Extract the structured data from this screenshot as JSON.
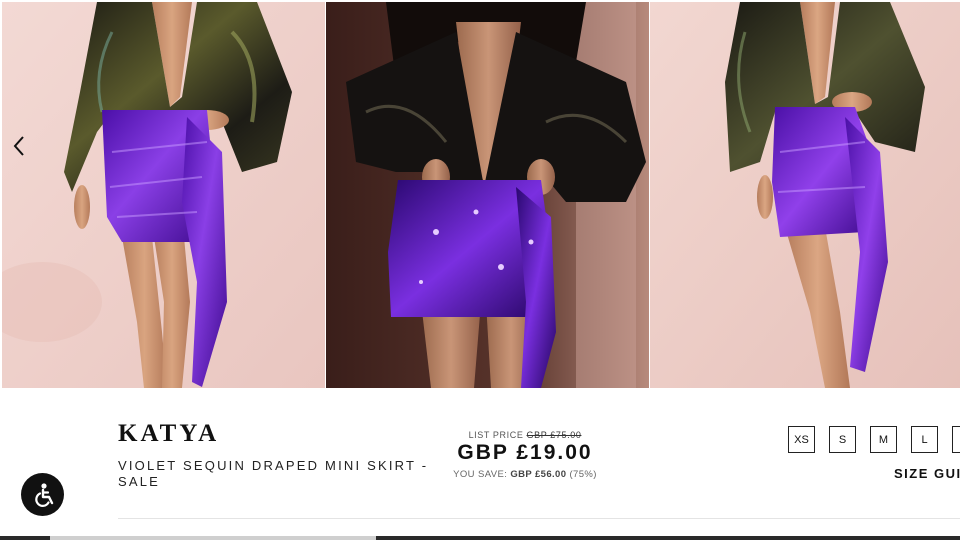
{
  "product": {
    "brand": "KATYA",
    "title": "VIOLET SEQUIN DRAPED MINI SKIRT - SALE"
  },
  "pricing": {
    "list_price_label": "LIST PRICE",
    "list_price": "GBP £75.00",
    "current_price": "GBP £19.00",
    "you_save_label": "YOU SAVE:",
    "you_save_amount": "GBP £56.00",
    "you_save_percent": "(75%)"
  },
  "sizes": [
    "XS",
    "S",
    "M",
    "L",
    ""
  ],
  "size_guide_label": "SIZE GUIDE",
  "icons": {
    "carousel_prev": "chevron-left-icon",
    "accessibility": "accessibility-icon"
  },
  "colors": {
    "skirt_violet": "#6a1fc8",
    "blouse_black": "#111111",
    "background_pink": "#efd2cc"
  }
}
